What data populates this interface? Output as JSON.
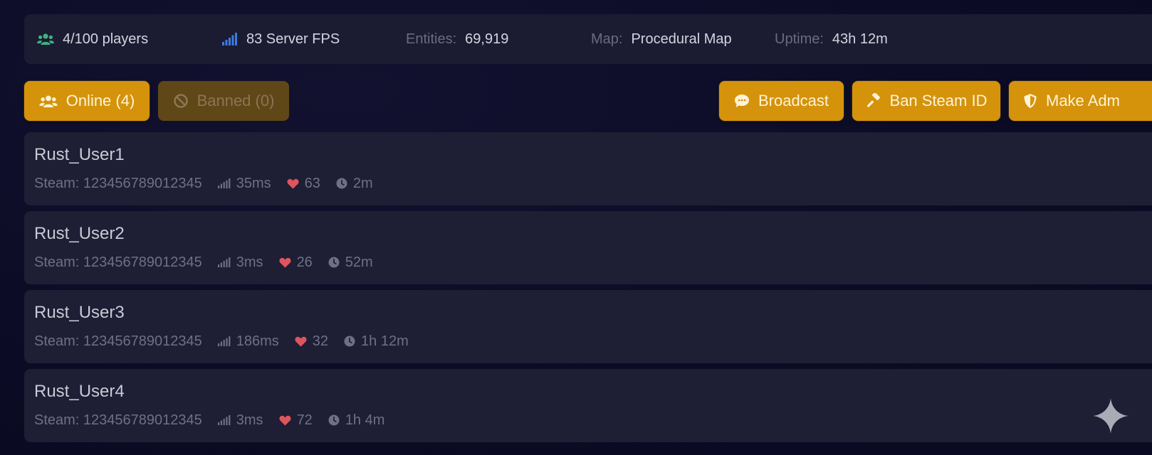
{
  "stats": {
    "players": {
      "value": "4/100 players",
      "icon": "users-icon"
    },
    "fps": {
      "value": "83 Server FPS",
      "icon": "signal-bars-icon"
    },
    "entities": {
      "label": "Entities:",
      "value": "69,919"
    },
    "map": {
      "label": "Map:",
      "value": "Procedural Map"
    },
    "uptime": {
      "label": "Uptime:",
      "value": "43h 12m"
    }
  },
  "tabs": {
    "online": {
      "label": "Online (4)",
      "icon": "users-icon",
      "active": true
    },
    "banned": {
      "label": "Banned (0)",
      "icon": "ban-icon",
      "active": false
    }
  },
  "actions": {
    "broadcast": {
      "label": "Broadcast",
      "icon": "chat-bubble-icon"
    },
    "ban_steam_id": {
      "label": "Ban Steam ID",
      "icon": "gavel-icon"
    },
    "make_admin": {
      "label": "Make Adm",
      "icon": "shield-icon"
    }
  },
  "players": [
    {
      "name": "Rust_User1",
      "steam": "Steam: 123456789012345",
      "ping": "35ms",
      "health": "63",
      "time": "2m"
    },
    {
      "name": "Rust_User2",
      "steam": "Steam: 123456789012345",
      "ping": "3ms",
      "health": "26",
      "time": "52m"
    },
    {
      "name": "Rust_User3",
      "steam": "Steam: 123456789012345",
      "ping": "186ms",
      "health": "32",
      "time": "1h 12m"
    },
    {
      "name": "Rust_User4",
      "steam": "Steam: 123456789012345",
      "ping": "3ms",
      "health": "72",
      "time": "1h 4m"
    }
  ],
  "colors": {
    "background": "#0b0b25",
    "panel": "#1b1b32",
    "card": "#1e1e34",
    "accent": "#d4930b",
    "accent_dim": "#5f4718",
    "players_icon": "#3fb27f",
    "fps_icon": "#3c7be0",
    "heart": "#e0545e"
  }
}
